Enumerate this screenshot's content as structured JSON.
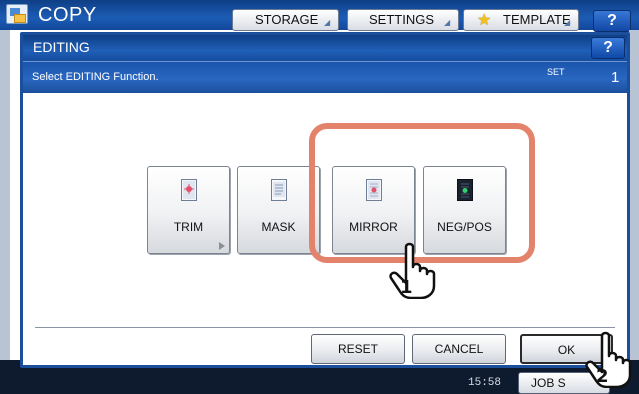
{
  "background": {
    "app_title": "COPY",
    "tabs": [
      {
        "label": "STORAGE"
      },
      {
        "label": "SETTINGS"
      },
      {
        "label": "TEMPLATE"
      }
    ],
    "help_label": "?",
    "time_text": "15:58",
    "job_status_label": "JOB S"
  },
  "dialog": {
    "title": "EDITING",
    "help_label": "?",
    "message": "Select EDITING Function.",
    "set_label": "SET",
    "set_count": "1",
    "functions": [
      {
        "label": "TRIM",
        "icon": "trim-icon"
      },
      {
        "label": "MASK",
        "icon": "mask-icon"
      },
      {
        "label": "MIRROR",
        "icon": "mirror-icon"
      },
      {
        "label": "NEG/POS",
        "icon": "negpos-icon"
      }
    ],
    "actions": {
      "reset": "RESET",
      "cancel": "CANCEL",
      "ok": "OK"
    }
  },
  "callouts": {
    "step1": "1",
    "step2": "2"
  },
  "colors": {
    "title_bar": "#1c5cb5",
    "highlight": "#e4836c"
  }
}
